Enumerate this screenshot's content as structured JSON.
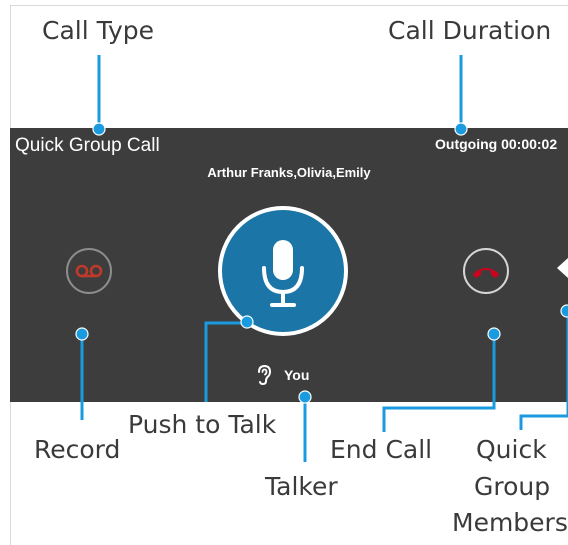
{
  "callouts": {
    "call_type": "Call Type",
    "call_duration": "Call Duration",
    "record": "Record",
    "push_to_talk": "Push to Talk",
    "talker": "Talker",
    "end_call": "End Call",
    "quick_group_members_line1": "Quick",
    "quick_group_members_line2": "Group",
    "quick_group_members_line3": "Members"
  },
  "call_screen": {
    "call_type": "Quick Group Call",
    "duration": "Outgoing 00:00:02",
    "participants": "Arthur Franks,Olivia,Emily",
    "talker_name": "You"
  },
  "icons": {
    "record": "voicemail-icon",
    "push_to_talk": "microphone-icon",
    "end_call": "phone-hangup-icon",
    "talker": "ear-icon",
    "members": "chevron-left-icon"
  },
  "colors": {
    "panel_background": "#3d3d3d",
    "ptt_blue": "#1b75a6",
    "callout_blue": "#1a9be0",
    "end_call_red": "#d0021b",
    "record_red": "#c0392b"
  }
}
